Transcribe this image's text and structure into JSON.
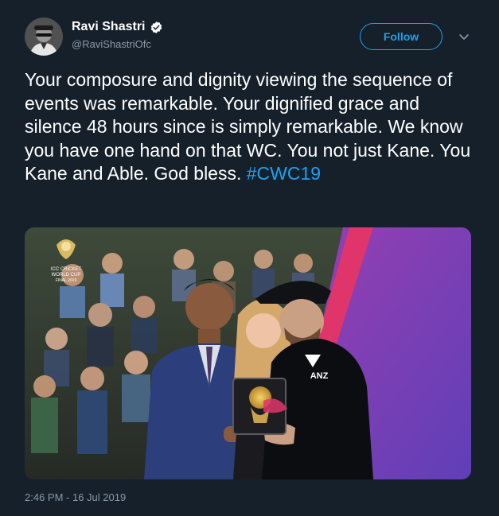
{
  "author": {
    "display_name": "Ravi Shastri",
    "handle": "@RaviShastriOfc",
    "verified": true
  },
  "actions": {
    "follow_label": "Follow"
  },
  "tweet": {
    "text": "Your composure and dignity viewing the sequence of events was remarkable. Your dignified grace and silence 48 hours since is simply remarkable. We know you have one hand on that WC. You not just Kane. You Kane and Able. God bless. ",
    "hashtag": "#CWC19",
    "timestamp": "2:46 PM - 16 Jul 2019"
  },
  "media": {
    "logo_text": {
      "line1": "ICC CRICKET",
      "line2": "WORLD CUP",
      "line3": "FINAL 2019"
    },
    "jersey_text": "ANZ"
  },
  "colors": {
    "background": "#15202b",
    "accent": "#1da1f2",
    "secondary_text": "#8899a6",
    "stage_pink": "#e0356b",
    "stage_purple": "#7a4fc0"
  }
}
